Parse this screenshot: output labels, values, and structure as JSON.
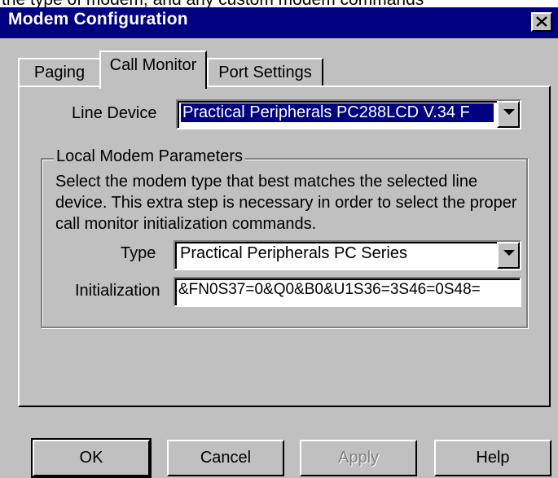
{
  "caption_fragment": "the type of modem, and any custom modem commands",
  "window": {
    "title": "Modem Configuration"
  },
  "tabs": [
    {
      "label": "Paging"
    },
    {
      "label": "Call Monitor",
      "active": true
    },
    {
      "label": "Port Settings"
    }
  ],
  "line_device": {
    "label": "Line Device",
    "value": "Practical Peripherals PC288LCD V.34 F"
  },
  "local_modem": {
    "group_title": "Local Modem Parameters",
    "description": "Select the modem type that best matches the selected line device.  This extra step is necessary in order to select the proper call monitor initialization commands.",
    "type_label": "Type",
    "type_value": "Practical Peripherals PC Series",
    "init_label": "Initialization",
    "init_value": "&FN0S37=0&Q0&B0&U1S36=3S46=0S48="
  },
  "buttons": {
    "ok": "OK",
    "cancel": "Cancel",
    "apply": "Apply",
    "help": "Help"
  },
  "colors": {
    "titlebar": "#000080",
    "face": "#c0c0c0",
    "selection": "#000080"
  }
}
